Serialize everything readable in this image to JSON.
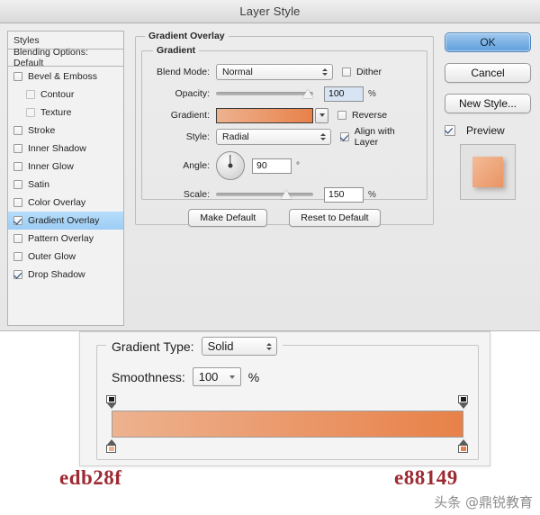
{
  "window": {
    "title": "Layer Style"
  },
  "sidebar": {
    "styles_label": "Styles",
    "blending_label": "Blending Options: Default",
    "items": [
      {
        "label": "Bevel & Emboss",
        "checked": false,
        "indent": false,
        "selected": false
      },
      {
        "label": "Contour",
        "checked": false,
        "indent": true,
        "selected": false
      },
      {
        "label": "Texture",
        "checked": false,
        "indent": true,
        "selected": false
      },
      {
        "label": "Stroke",
        "checked": false,
        "indent": false,
        "selected": false
      },
      {
        "label": "Inner Shadow",
        "checked": false,
        "indent": false,
        "selected": false
      },
      {
        "label": "Inner Glow",
        "checked": false,
        "indent": false,
        "selected": false
      },
      {
        "label": "Satin",
        "checked": false,
        "indent": false,
        "selected": false
      },
      {
        "label": "Color Overlay",
        "checked": false,
        "indent": false,
        "selected": false
      },
      {
        "label": "Gradient Overlay",
        "checked": true,
        "indent": false,
        "selected": true
      },
      {
        "label": "Pattern Overlay",
        "checked": false,
        "indent": false,
        "selected": false
      },
      {
        "label": "Outer Glow",
        "checked": false,
        "indent": false,
        "selected": false
      },
      {
        "label": "Drop Shadow",
        "checked": true,
        "indent": false,
        "selected": false
      }
    ]
  },
  "panel": {
    "outer_legend": "Gradient Overlay",
    "inner_legend": "Gradient",
    "blend_mode": {
      "label": "Blend Mode:",
      "value": "Normal"
    },
    "opacity": {
      "label": "Opacity:",
      "value": "100",
      "unit": "%",
      "percent": 100
    },
    "gradient": {
      "label": "Gradient:",
      "start_color": "#edb28f",
      "end_color": "#e88149"
    },
    "style": {
      "label": "Style:",
      "value": "Radial"
    },
    "angle": {
      "label": "Angle:",
      "value": "90",
      "unit": "°"
    },
    "scale": {
      "label": "Scale:",
      "value": "150",
      "unit": "%",
      "percent": 75
    },
    "dither": {
      "label": "Dither",
      "checked": false
    },
    "reverse": {
      "label": "Reverse",
      "checked": false
    },
    "align_with_layer": {
      "label": "Align with Layer",
      "checked": true
    },
    "make_default": "Make Default",
    "reset_to_default": "Reset to Default"
  },
  "actions": {
    "ok": "OK",
    "cancel": "Cancel",
    "new_style": "New Style...",
    "preview": {
      "label": "Preview",
      "checked": true
    }
  },
  "editor": {
    "gradient_type": {
      "label": "Gradient Type:",
      "value": "Solid"
    },
    "smoothness": {
      "label": "Smoothness:",
      "value": "100",
      "unit": "%"
    },
    "bar": {
      "start_color": "#edb28f",
      "end_color": "#e88149"
    },
    "opacity_stops": [
      {
        "position_pct": 0,
        "color": "#1c1c1c"
      },
      {
        "position_pct": 100,
        "color": "#1c1c1c"
      }
    ],
    "color_stops": [
      {
        "position_pct": 0,
        "color": "#edb28f"
      },
      {
        "position_pct": 100,
        "color": "#e88149"
      }
    ]
  },
  "annotations": {
    "left_hex": "edb28f",
    "right_hex": "e88149",
    "hex_color": "#9d2b33",
    "watermark": "头条 @鼎锐教育"
  }
}
